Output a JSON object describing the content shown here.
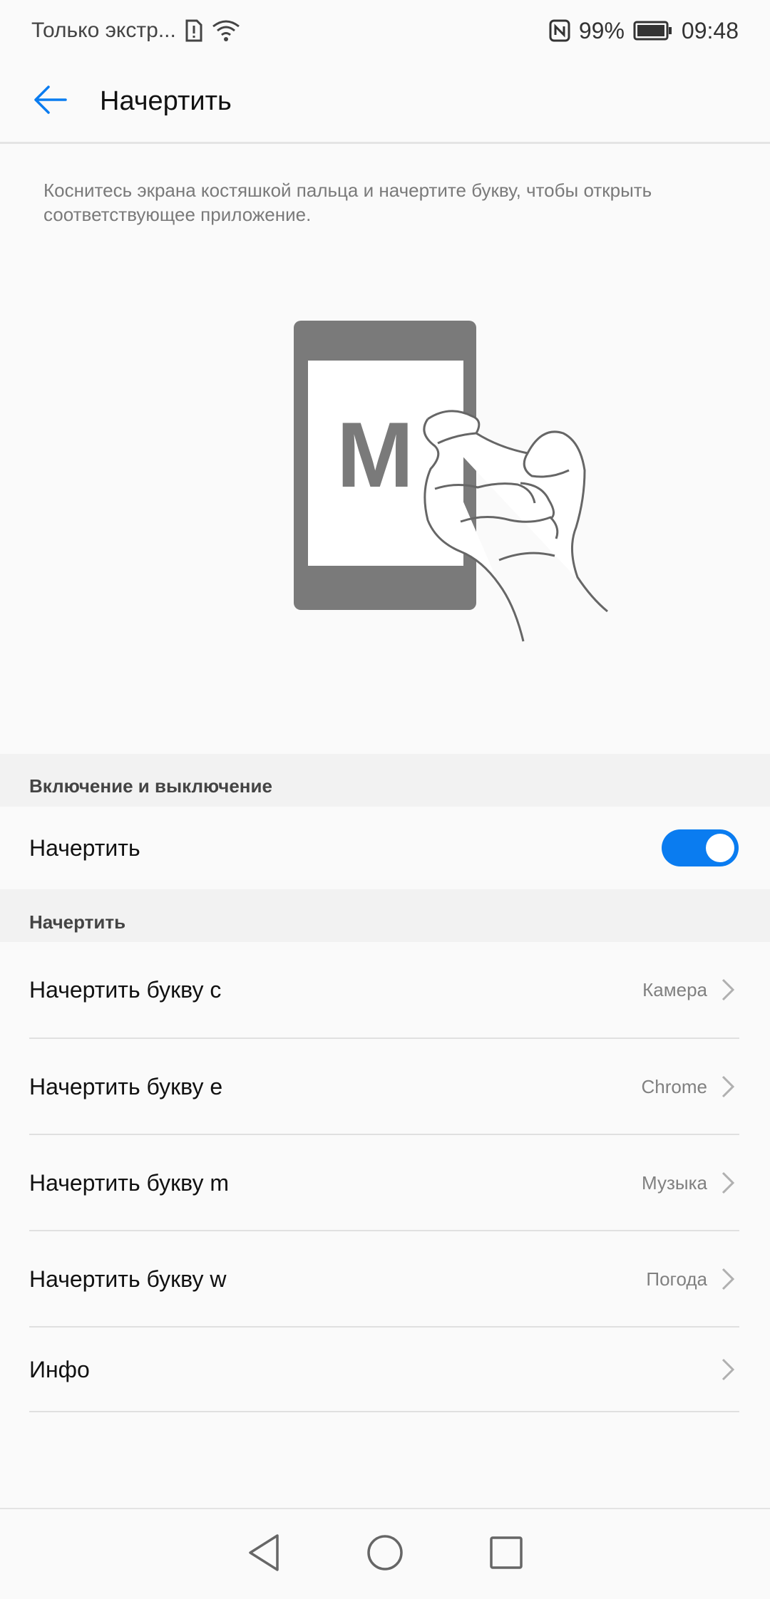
{
  "status_bar": {
    "carrier_text": "Только экстр...",
    "battery": "99%",
    "time": "09:48",
    "icons": [
      "sim-alert-icon",
      "wifi-icon",
      "nfc-icon",
      "battery-icon"
    ]
  },
  "header": {
    "title": "Начертить",
    "back_icon": "arrow-left-icon"
  },
  "description": "Коснитесь экрана костяшкой пальца и начертите букву, чтобы открыть соответствующее приложение.",
  "illustration": {
    "letter": "M"
  },
  "sections": {
    "toggle_section": {
      "header": "Включение и выключение",
      "row_label": "Начертить",
      "toggle_on": true
    },
    "letters_section": {
      "header": "Начертить",
      "items": [
        {
          "label": "Начертить букву c",
          "value": "Камера"
        },
        {
          "label": "Начертить букву e",
          "value": "Chrome"
        },
        {
          "label": "Начертить букву m",
          "value": "Музыка"
        },
        {
          "label": "Начертить букву w",
          "value": "Погода"
        },
        {
          "label": "Инфо",
          "value": ""
        }
      ]
    }
  },
  "colors": {
    "accent": "#0a7cf0",
    "background": "#fafafa",
    "section_bg": "#f2f2f2"
  }
}
